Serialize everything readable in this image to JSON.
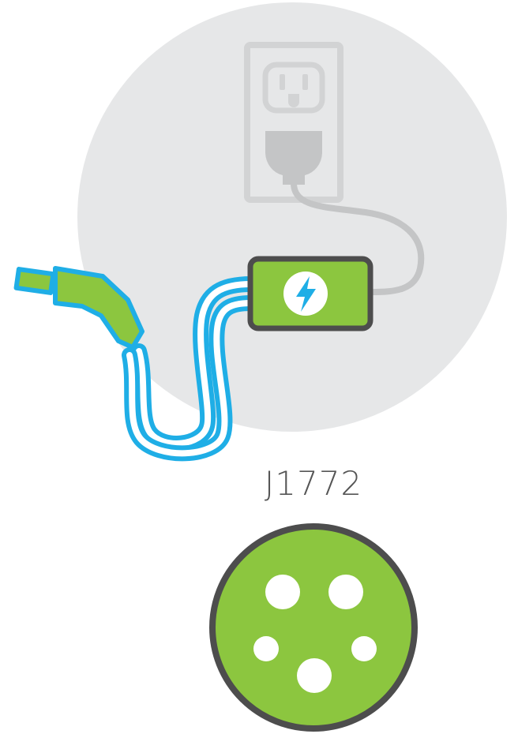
{
  "connector": {
    "name": "J1772"
  },
  "icons": {
    "outlet": "wall-outlet-icon",
    "adapter": "charging-adapter-icon",
    "plug": "ev-charging-plug-icon",
    "connector_face": "j1772-connector-face-icon",
    "bolt": "lightning-bolt-icon"
  },
  "colors": {
    "background_disc": "#e6e7e8",
    "outlet_gray": "#cfd0d1",
    "cord_gray": "#b9babb",
    "adapter_green": "#8cc63f",
    "outline_dark": "#4d4d4d",
    "cable_blue": "#1faee6",
    "white": "#ffffff"
  }
}
